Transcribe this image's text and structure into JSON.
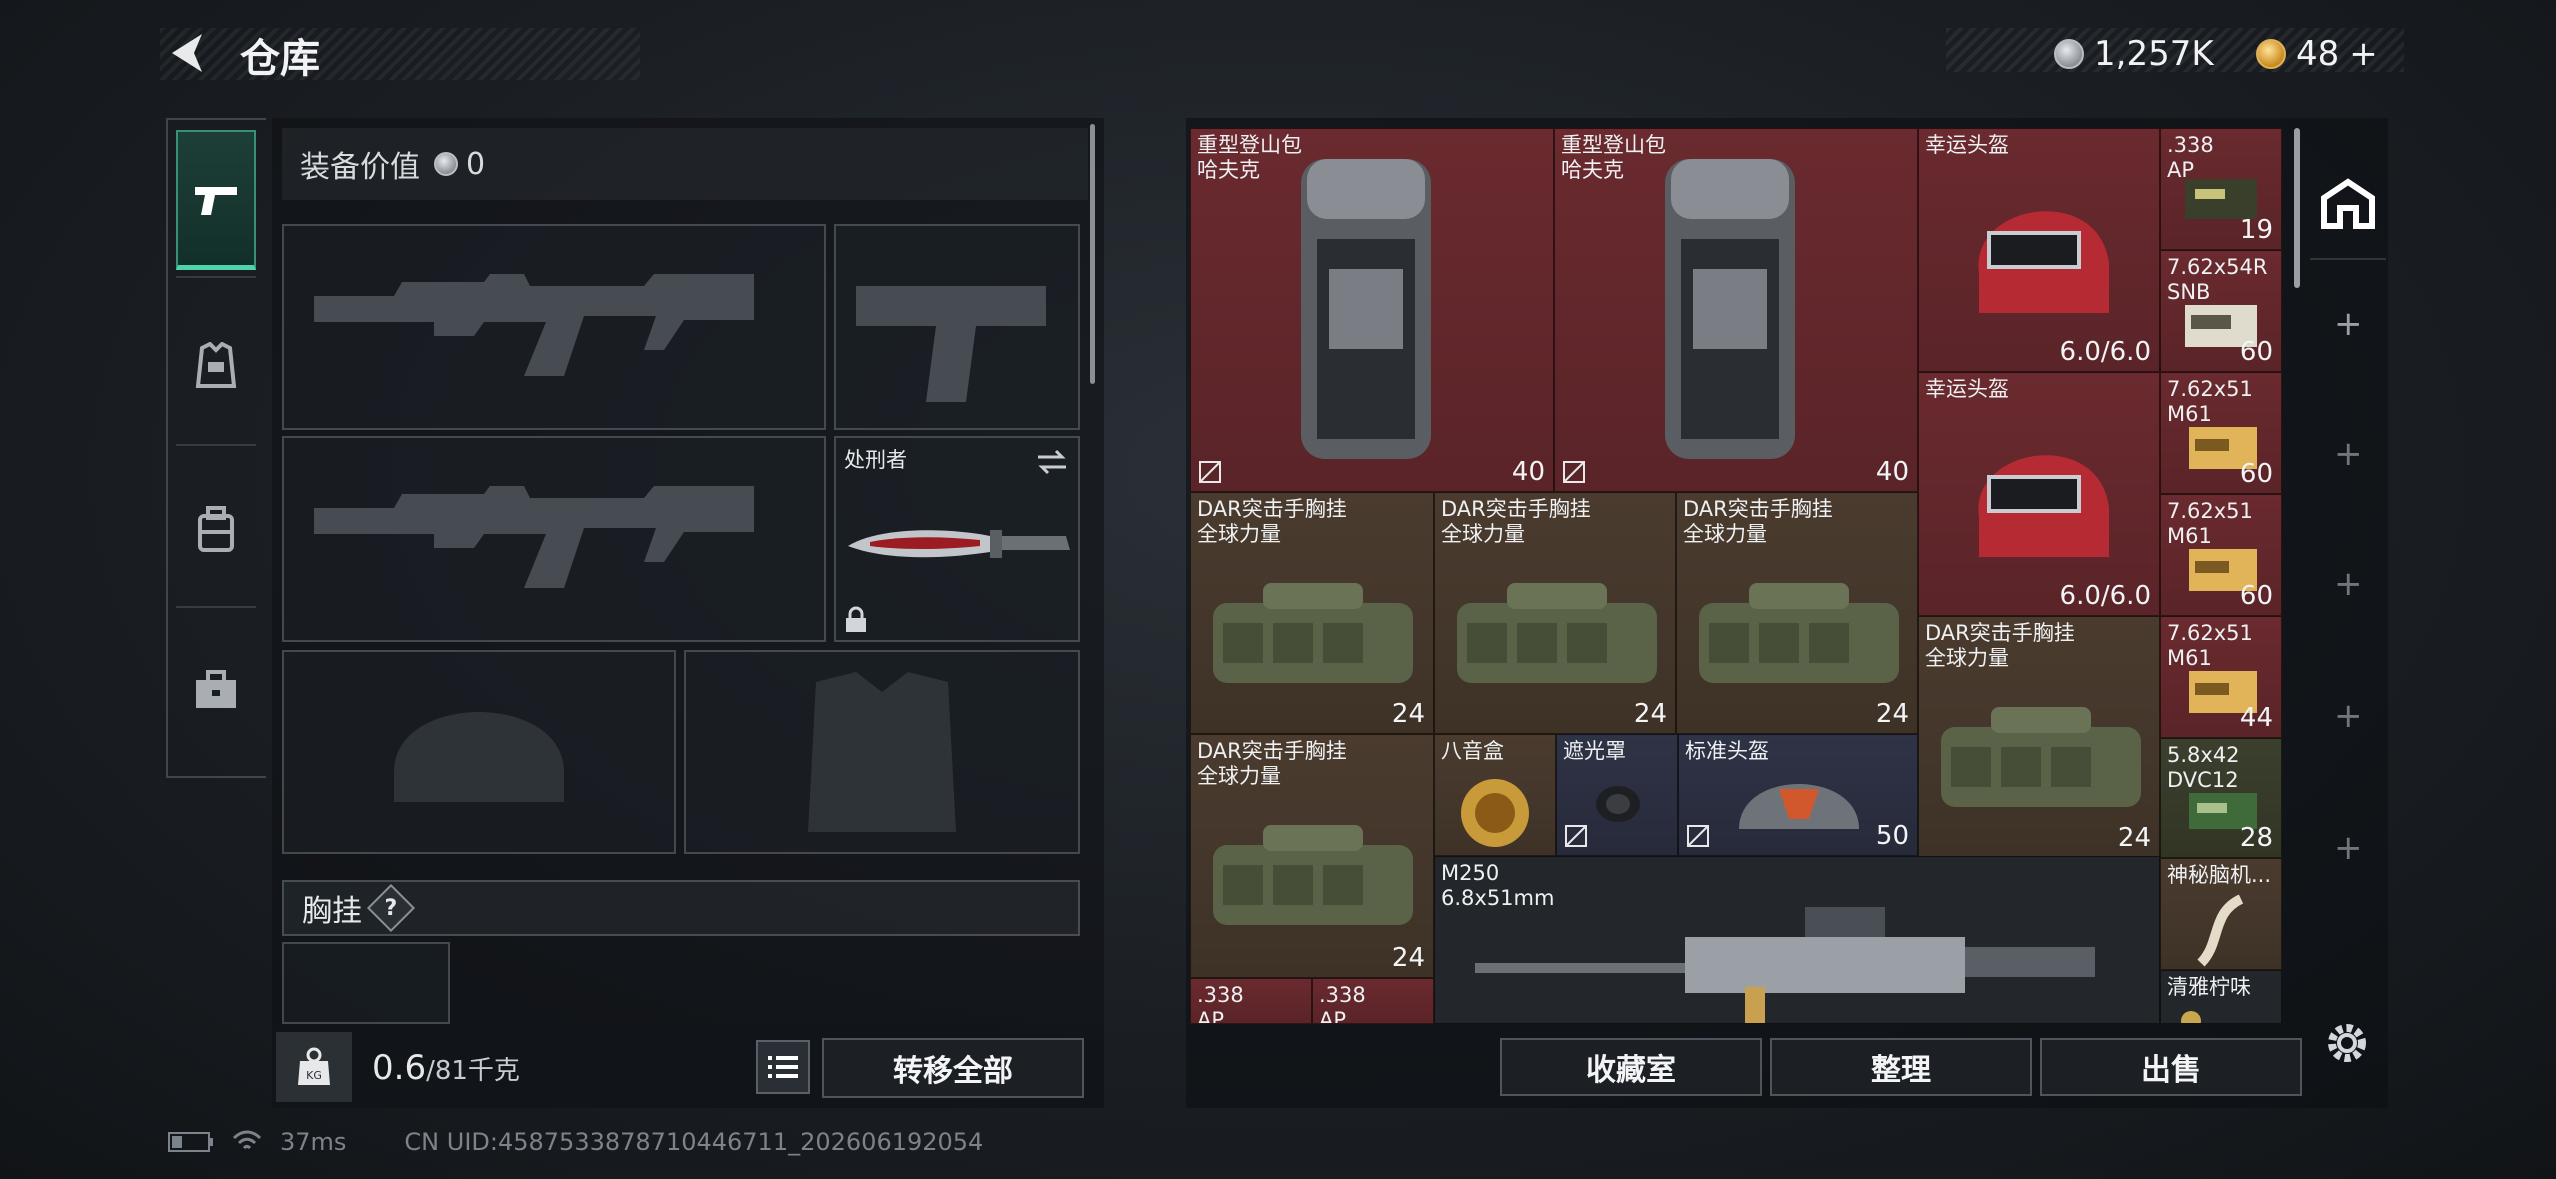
{
  "header": {
    "title": "仓库",
    "silver_amount": "1,257K",
    "gold_amount": "48",
    "gold_plus": "+"
  },
  "equip": {
    "value_label": "装备价值",
    "value": "0",
    "knife_name": "处刑者",
    "chest_label": "胸挂",
    "help": "?"
  },
  "weight": {
    "kg_icon": "KG",
    "current": "0.6",
    "capacity": "/81千克",
    "transfer_all": "转移全部"
  },
  "stash": {
    "items": [
      {
        "name": "重型登山包\n哈夫克",
        "value": "40"
      },
      {
        "name": "重型登山包\n哈夫克",
        "value": "40"
      },
      {
        "name": "幸运头盔",
        "value": "6.0/6.0"
      },
      {
        "name": ".338\nAP",
        "value": "19"
      },
      {
        "name": "7.62x54R\nSNB",
        "value": "60"
      },
      {
        "name": "幸运头盔",
        "value": "6.0/6.0"
      },
      {
        "name": "7.62x51\nM61",
        "value": "60"
      },
      {
        "name": "DAR突击手胸挂\n全球力量",
        "value": "24"
      },
      {
        "name": "DAR突击手胸挂\n全球力量",
        "value": "24"
      },
      {
        "name": "DAR突击手胸挂\n全球力量",
        "value": "24"
      },
      {
        "name": "7.62x51\nM61",
        "value": "60"
      },
      {
        "name": "DAR突击手胸挂\n全球力量",
        "value": "24"
      },
      {
        "name": "7.62x51\nM61",
        "value": "44"
      },
      {
        "name": "DAR突击手胸挂\n全球力量",
        "value": "24"
      },
      {
        "name": "八音盒",
        "value": ""
      },
      {
        "name": "遮光罩",
        "value": ""
      },
      {
        "name": "标准头盔",
        "value": "50"
      },
      {
        "name": "5.8x42\nDVC12",
        "value": "28"
      },
      {
        "name": "M250\n6.8x51mm",
        "value": ""
      },
      {
        "name": "神秘脑机...",
        "value": ""
      },
      {
        "name": "清雅柠味",
        "value": ""
      },
      {
        "name": ".338\nAP",
        "value": ""
      },
      {
        "name": ".338\nAP",
        "value": ""
      }
    ],
    "buttons": {
      "collection": "收藏室",
      "sort": "整理",
      "sell": "出售"
    }
  },
  "status": {
    "ping": "37ms",
    "uid": "CN UID:4587533878710446711_202606192054"
  },
  "colors": {
    "accent": "#4fd3a8",
    "red_rarity": "#6a2a2f",
    "gold_rarity": "#4a3b2e",
    "purple_rarity": "#2f3346"
  }
}
